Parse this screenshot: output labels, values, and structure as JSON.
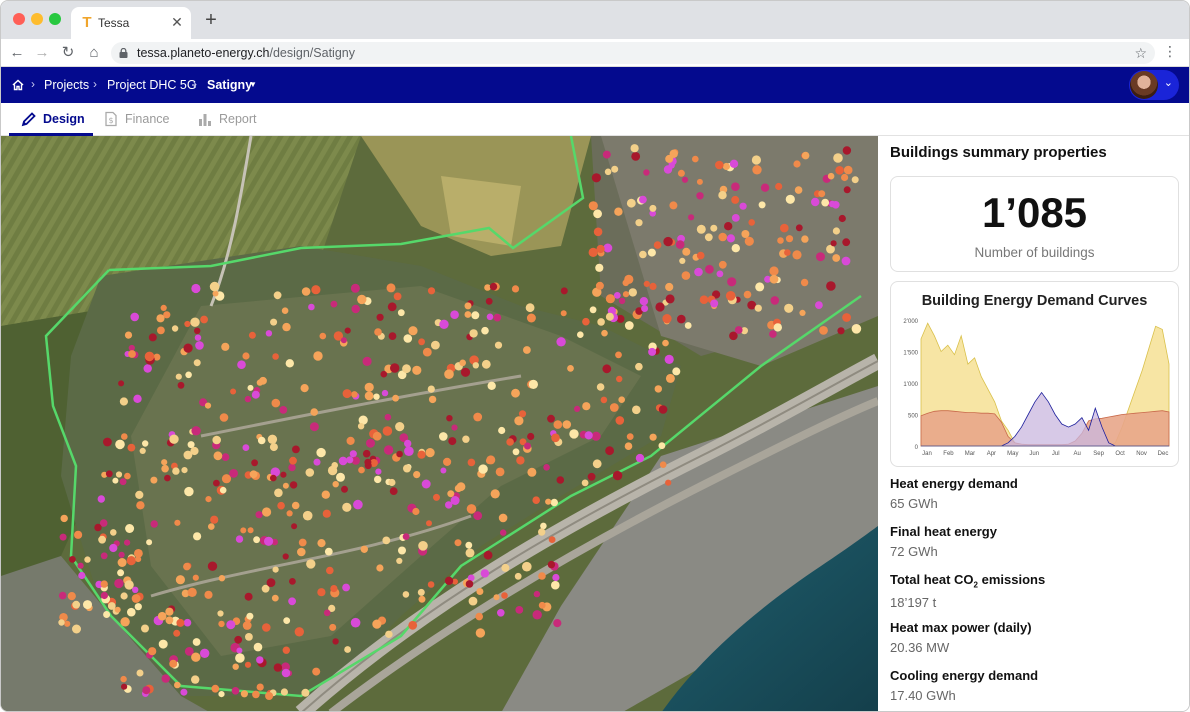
{
  "browser": {
    "tab_title": "Tessa",
    "url_host": "tessa.planeto-energy.ch",
    "url_path": "/design/Satigny"
  },
  "breadcrumb": {
    "items": [
      "Projects",
      "Project DHC 5G",
      "Satigny"
    ]
  },
  "tabs": [
    {
      "label": "Design",
      "icon": "pencil-icon",
      "active": true
    },
    {
      "label": "Finance",
      "icon": "document-dollar-icon",
      "active": false
    },
    {
      "label": "Report",
      "icon": "bar-chart-icon",
      "active": false
    }
  ],
  "panel": {
    "title": "Buildings summary properties",
    "building_count": "1’085",
    "building_count_label": "Number of buildings",
    "metrics": [
      {
        "label": "Heat energy demand",
        "value": "65 GWh"
      },
      {
        "label": "Final heat energy",
        "value": "72 GWh"
      },
      {
        "label_main": "Total heat CO",
        "label_sub": "2",
        "label_tail": " emissions",
        "value": "18’197 t"
      },
      {
        "label": "Heat max power (daily)",
        "value": "20.36 MW"
      },
      {
        "label": "Cooling energy demand",
        "value": "17.40 GWh"
      }
    ]
  },
  "chart_data": {
    "type": "area",
    "title": "Building Energy Demand Curves",
    "xlabel": "",
    "ylabel": "",
    "x_ticks": [
      "Jan",
      "Feb",
      "Mar",
      "Apr",
      "May",
      "Jun",
      "Jul",
      "Au",
      "Sep",
      "Oct",
      "Nov",
      "Dec"
    ],
    "y_ticks": [
      "0",
      "500",
      "1’000",
      "1’500",
      "2’000"
    ],
    "ylim": [
      0,
      2000
    ],
    "series": [
      {
        "color": "#f6e29a",
        "stroke": "#d9c04a",
        "values": [
          1700,
          1950,
          1750,
          1500,
          1600,
          1450,
          1750,
          1300,
          1400,
          1100,
          900,
          700,
          400,
          250,
          50,
          0,
          0,
          0,
          0,
          0,
          0,
          0,
          0,
          0,
          0,
          0,
          0,
          0,
          0,
          50,
          300,
          600,
          900,
          1200,
          1550,
          1900,
          1850,
          1300
        ]
      },
      {
        "color": "#e8a689",
        "stroke": "#c8694a",
        "values": [
          480,
          520,
          550,
          560,
          560,
          550,
          540,
          530,
          530,
          520,
          520,
          510,
          380,
          150,
          50,
          30,
          20,
          20,
          20,
          20,
          20,
          20,
          30,
          80,
          200,
          400,
          430,
          440,
          460,
          480,
          500,
          510,
          520,
          530,
          540,
          550,
          560,
          540
        ]
      },
      {
        "color": "#cab7df",
        "stroke": "#1d1f9c",
        "values": [
          0,
          0,
          0,
          0,
          0,
          0,
          0,
          0,
          0,
          0,
          0,
          0,
          0,
          50,
          150,
          300,
          500,
          700,
          850,
          700,
          500,
          350,
          300,
          350,
          450,
          250,
          600,
          300,
          50,
          0,
          0,
          0,
          0,
          0,
          0,
          0,
          0,
          0
        ]
      }
    ]
  }
}
